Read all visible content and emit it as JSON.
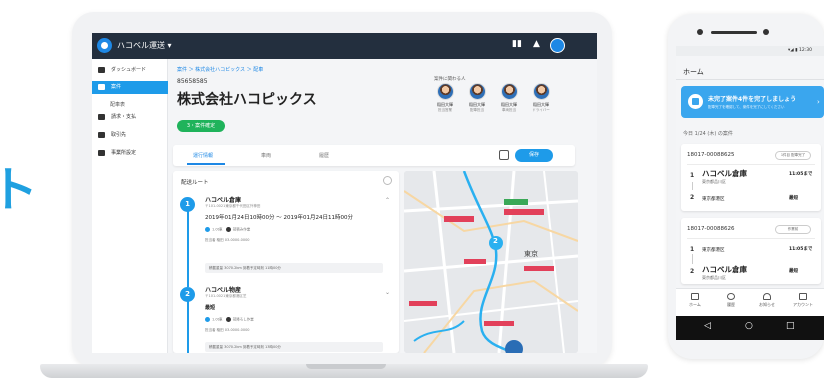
{
  "hero": {
    "partial_text": "ト"
  },
  "laptop": {
    "app_title": "ハコベル運送 ▾",
    "sidebar": {
      "items": [
        {
          "label": "ダッシュボード"
        },
        {
          "label": "案件"
        },
        {
          "label": "請求・支払"
        },
        {
          "label": "取引先"
        },
        {
          "label": "事業所設定"
        }
      ],
      "sub_items": [
        {
          "label": "配車表"
        }
      ]
    },
    "breadcrumb": "案件 ＞ 株式会社ハコピックス ＞ 配車",
    "doc_number": "85658585",
    "company_name": "株式会社ハコピックス",
    "status_badge": "3・案件確定",
    "people_label": "案件に関わる人",
    "people": [
      {
        "name": "稲田大輝",
        "role": "担当営業"
      },
      {
        "name": "稲田大輝",
        "role": "配車担当"
      },
      {
        "name": "稲田大輝",
        "role": "車両担当"
      },
      {
        "name": "稲田大輝",
        "role": "ドライバー"
      }
    ],
    "tabs": [
      {
        "label": "運行情報"
      },
      {
        "label": "車両"
      },
      {
        "label": "履歴"
      }
    ],
    "save_label": "保存",
    "route": {
      "title": "配送ルート",
      "stops": [
        {
          "number": "1",
          "name": "ハコベル倉庫",
          "address": "〒101-0021東京都千代田区外神田",
          "time": "2019年01月24日10時00分 ～ 2019年01月24日11時00分",
          "meta_a": "1.0t車",
          "meta_b": "荷積み作業",
          "note": "担当者 稲田 03-0000-0000",
          "summary": "積載重量 3070.2km    到着予定時刻 11時00分"
        },
        {
          "number": "2",
          "name": "ハコベル物産",
          "address": "〒101-0021東京都港区芝",
          "arrival": "最短",
          "meta_a": "1.0t車",
          "meta_b": "荷降ろし作業",
          "note": "担当者 稲田 03-0000-0000",
          "summary": "積載重量 3070.2km    到着予定時刻 13時00分"
        }
      ]
    },
    "map": {
      "marker_label": "2",
      "city_label": "東京"
    }
  },
  "phone": {
    "status_text": "▾◢ ▮ 12:30",
    "home_title": "ホーム",
    "banner_title": "未完了案件4件を完了しましょう",
    "banner_subtitle": "配車完了を確認して、案件を完了にしてください",
    "date_label": "今日 1/24 (木) の案件",
    "orders": [
      {
        "code": "18017-00088625",
        "badge": "1件目 配車完了",
        "stop1_num": "1",
        "stop1_label": "ハコベル倉庫",
        "stop1_sub": "東京都品川区",
        "stop1_right": "11:05まで",
        "stop2_num": "2",
        "stop2_label": "東京都港区",
        "stop2_right": "最短"
      },
      {
        "code": "18017-00088626",
        "badge": "作業前",
        "stop1_num": "1",
        "stop1_label": "東京都港区",
        "stop1_right": "11:05まで",
        "stop2_num": "2",
        "stop2_label": "ハコベル倉庫",
        "stop2_sub": "東京都品川区",
        "stop2_right": "最短"
      }
    ],
    "bottom_nav": [
      {
        "label": "ホーム"
      },
      {
        "label": "履歴"
      },
      {
        "label": "お知らせ"
      },
      {
        "label": "アカウント"
      }
    ],
    "sys_nav": {
      "back": "◁",
      "home": "○",
      "recent": "□"
    }
  },
  "colors": {
    "accent": "#1e9be9",
    "header": "#232f3e",
    "success": "#1fb35b"
  }
}
